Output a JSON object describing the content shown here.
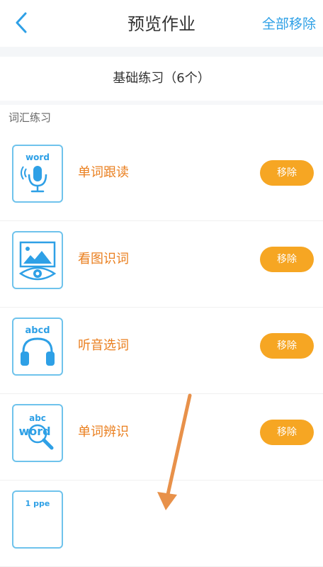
{
  "navbar": {
    "title": "预览作业",
    "back_icon": "chevron-left-icon",
    "remove_all_label": "全部移除"
  },
  "section": {
    "title": "基础练习（6个）"
  },
  "category": {
    "label": "词汇练习"
  },
  "items": [
    {
      "label": "单词跟读",
      "icon": "word-microphone-icon",
      "icon_text": "word",
      "remove_label": "移除"
    },
    {
      "label": "看图识词",
      "icon": "picture-eye-icon",
      "icon_text": "",
      "remove_label": "移除"
    },
    {
      "label": "听音选词",
      "icon": "abcd-headphones-icon",
      "icon_text": "abcd",
      "remove_label": "移除"
    },
    {
      "label": "单词辨识",
      "icon": "abc-word-magnifier-icon",
      "icon_text": "abc",
      "icon_text2": "word",
      "remove_label": "移除"
    },
    {
      "label": "",
      "icon": "partial-icon",
      "icon_text": "1 ppe",
      "remove_label": ""
    }
  ],
  "colors": {
    "accent_blue": "#2ea0e6",
    "icon_border": "#6fc3ec",
    "label_orange": "#ea7f1f",
    "button_orange": "#f6a623",
    "arrow_orange": "#e8914a"
  }
}
